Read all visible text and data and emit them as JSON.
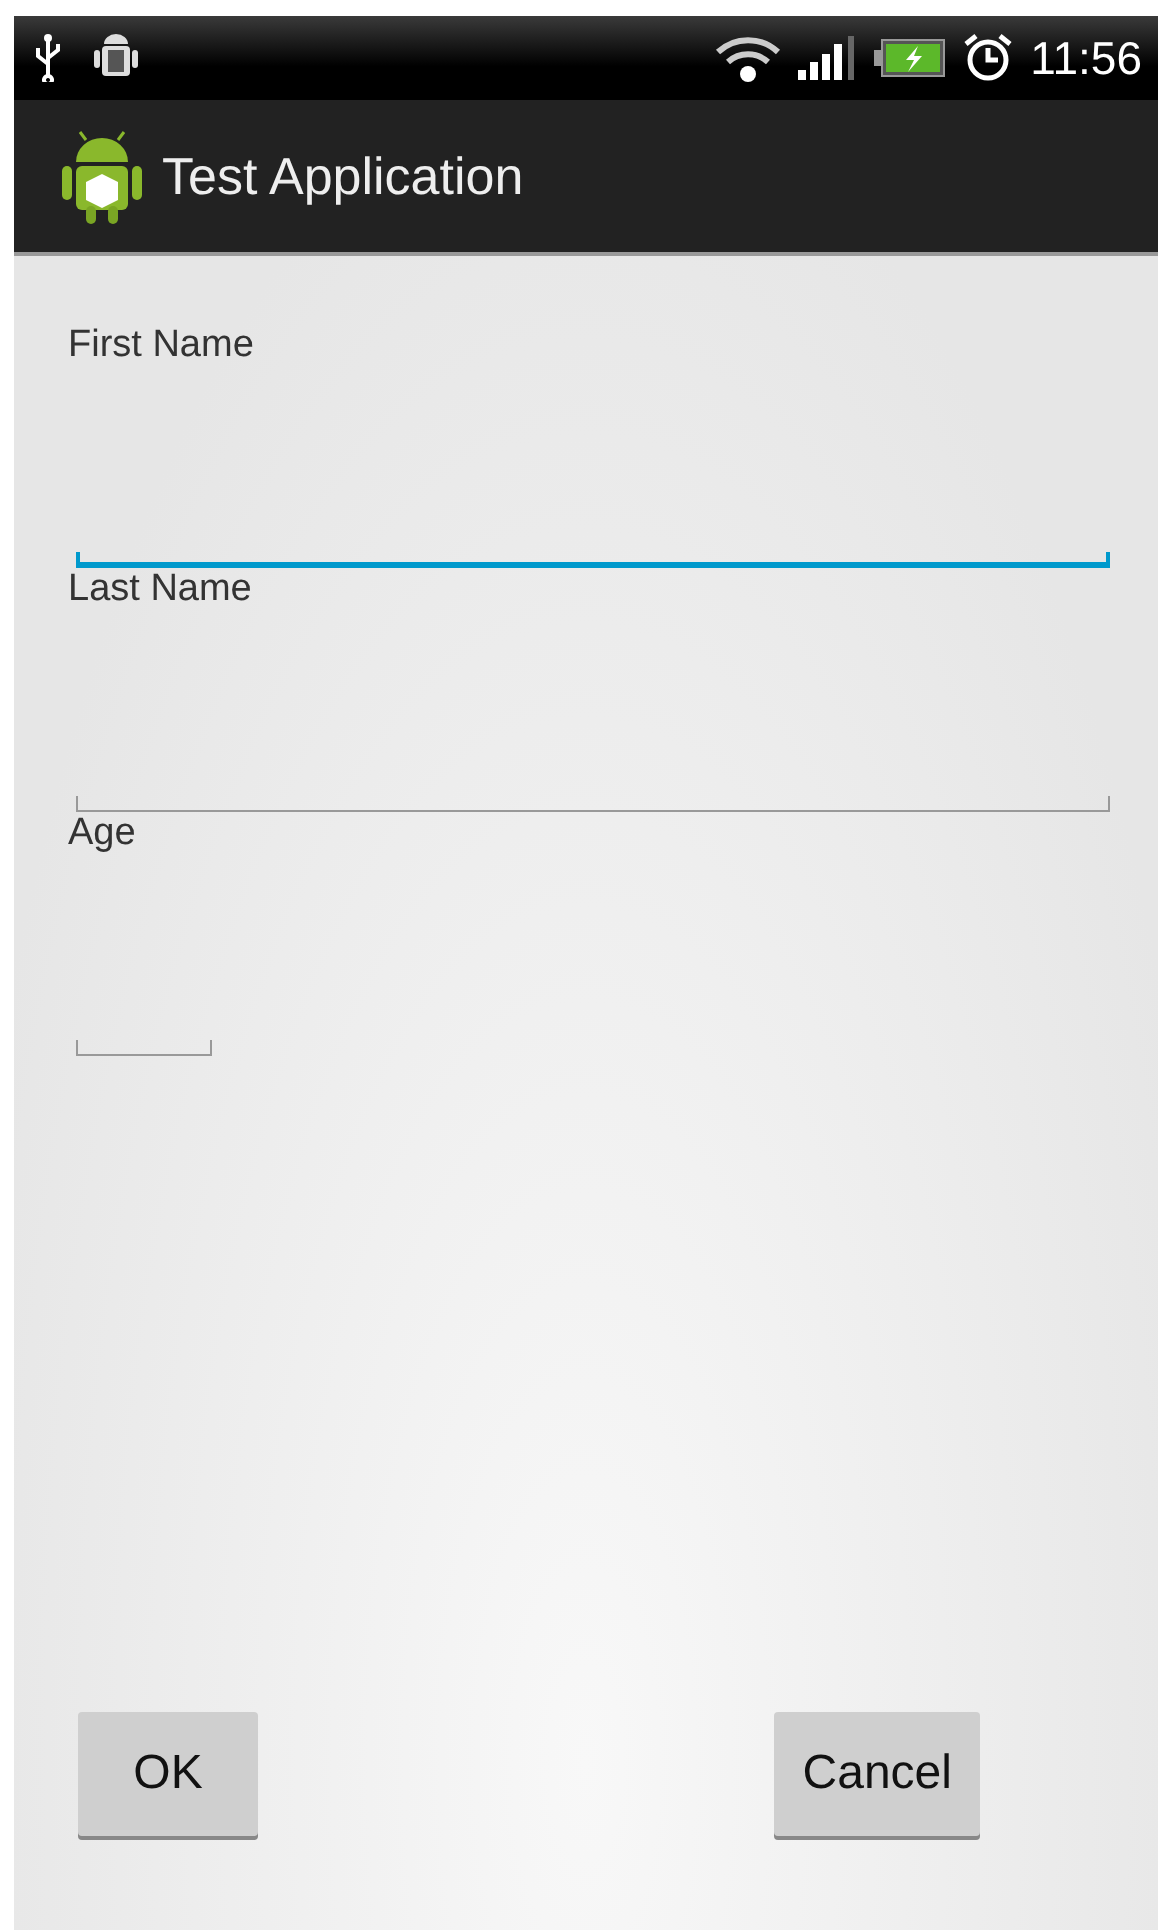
{
  "status_bar": {
    "time": "11:56"
  },
  "action_bar": {
    "title": "Test Application"
  },
  "fields": [
    {
      "label": "First Name",
      "focused": true,
      "kind": "wide"
    },
    {
      "label": "Last Name",
      "focused": false,
      "kind": "wide"
    },
    {
      "label": "Age",
      "focused": false,
      "kind": "short"
    }
  ],
  "buttons": [
    {
      "label": "OK"
    },
    {
      "label": "Cancel"
    }
  ]
}
